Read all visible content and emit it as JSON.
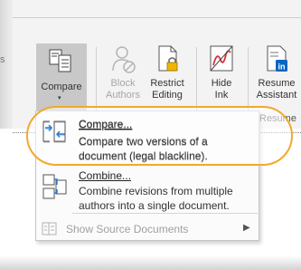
{
  "ribbon": {
    "left_hint": "s",
    "buttons": {
      "compare": {
        "label": "Compare",
        "icon": "compare-icon"
      },
      "block_authors": {
        "label_line1": "Block",
        "label_line2": "Authors",
        "icon": "block-authors-icon"
      },
      "restrict_editing": {
        "label_line1": "Restrict",
        "label_line2": "Editing",
        "icon": "restrict-editing-icon"
      },
      "hide_ink": {
        "label_line1": "Hide",
        "label_line2": "Ink",
        "icon": "hide-ink-icon"
      },
      "resume_assistant": {
        "label_line1": "Resume",
        "label_line2": "Assistant",
        "icon": "linkedin-resume-icon"
      }
    },
    "group_label": "Resume"
  },
  "dropdown": {
    "compare_item": {
      "title": "Compare...",
      "description": "Compare two versions of a document (legal blackline).",
      "icon": "compare-documents-icon"
    },
    "combine_item": {
      "title": "Combine...",
      "description": "Combine revisions from multiple authors into a single document.",
      "icon": "combine-documents-icon"
    },
    "show_source": {
      "label": "Show Source Documents",
      "icon": "source-documents-icon"
    }
  },
  "colors": {
    "highlight": "#f1a92b",
    "linkedin": "#0a66c2",
    "padlock": "#f0b400",
    "ink": "#d13438"
  }
}
